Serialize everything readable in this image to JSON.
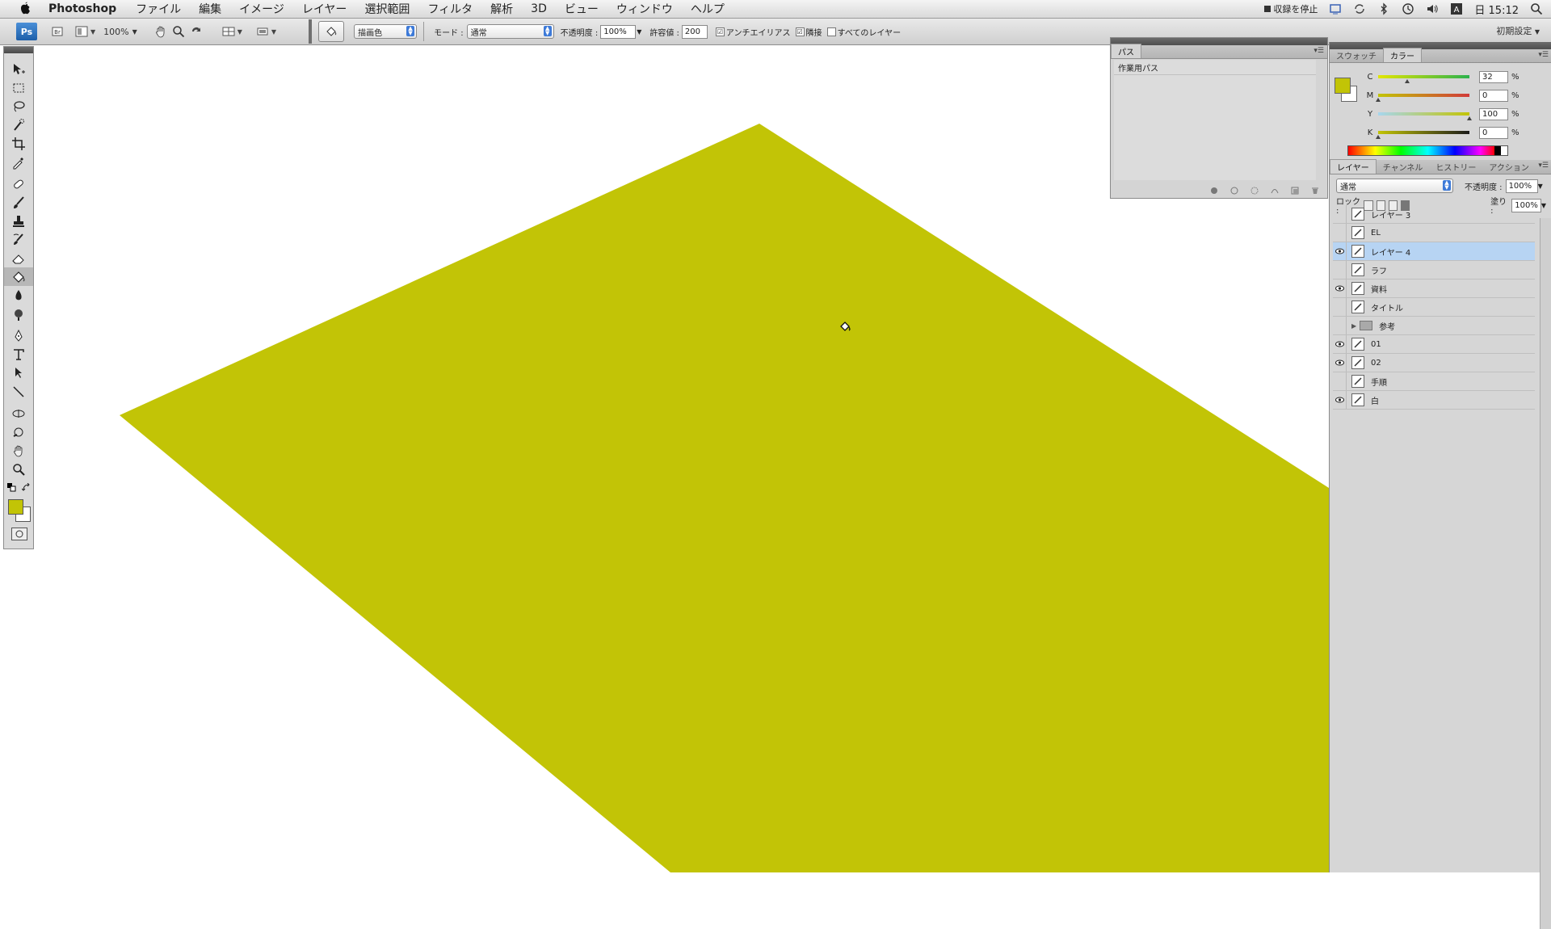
{
  "menubar": {
    "app_name": "Photoshop",
    "menus": [
      "ファイル",
      "編集",
      "イメージ",
      "レイヤー",
      "選択範囲",
      "フィルタ",
      "解析",
      "3D",
      "ビュー",
      "ウィンドウ",
      "ヘルプ"
    ],
    "status_stop": "収録を停止",
    "clock": "日 15:12"
  },
  "appbar": {
    "logo": "Ps",
    "zoom": "100%",
    "workspace": "初期設定"
  },
  "options": {
    "fill_source": "描画色",
    "mode_label": "モード :",
    "mode_value": "通常",
    "opacity_label": "不透明度 :",
    "opacity_value": "100%",
    "tolerance_label": "許容値 :",
    "tolerance_value": "200",
    "antialias_label": "アンチエイリアス",
    "contiguous_label": "隣接",
    "all_layers_label": "すべてのレイヤー",
    "antialias_checked": "☑",
    "contiguous_checked": "☑",
    "all_layers_checked": ""
  },
  "paths_panel": {
    "tab": "パス",
    "items": [
      "作業用パス"
    ]
  },
  "color_panel": {
    "tabs": [
      "スウォッチ",
      "カラー"
    ],
    "foreground_hex": "#c2c406",
    "channels": [
      {
        "label": "C",
        "value": "32",
        "unit": "%",
        "fraction": 0.32
      },
      {
        "label": "M",
        "value": "0",
        "unit": "%",
        "fraction": 0.0
      },
      {
        "label": "Y",
        "value": "100",
        "unit": "%",
        "fraction": 1.0
      },
      {
        "label": "K",
        "value": "0",
        "unit": "%",
        "fraction": 0.0
      }
    ]
  },
  "layers_panel": {
    "tabs": [
      "レイヤー",
      "チャンネル",
      "ヒストリー",
      "アクション"
    ],
    "blend_mode": "通常",
    "opacity_label": "不透明度 :",
    "opacity_value": "100%",
    "lock_label": "ロック :",
    "fill_label": "塗り :",
    "fill_value": "100%",
    "layers": [
      {
        "name": "レイヤー 3",
        "visible": false,
        "selected": false,
        "type": "layer"
      },
      {
        "name": "EL",
        "visible": false,
        "selected": false,
        "type": "layer"
      },
      {
        "name": "レイヤー 4",
        "visible": true,
        "selected": true,
        "type": "layer"
      },
      {
        "name": "ラフ",
        "visible": false,
        "selected": false,
        "type": "layer"
      },
      {
        "name": "資料",
        "visible": true,
        "selected": false,
        "type": "layer"
      },
      {
        "name": "タイトル",
        "visible": false,
        "selected": false,
        "type": "layer"
      },
      {
        "name": "参考",
        "visible": false,
        "selected": false,
        "type": "group"
      },
      {
        "name": "01",
        "visible": true,
        "selected": false,
        "type": "layer"
      },
      {
        "name": "02",
        "visible": true,
        "selected": false,
        "type": "layer"
      },
      {
        "name": "手順",
        "visible": false,
        "selected": false,
        "type": "layer"
      },
      {
        "name": "白",
        "visible": true,
        "selected": false,
        "type": "layer"
      }
    ]
  },
  "canvas": {
    "fill_color": "#c2c406",
    "background": "#ffffff"
  },
  "colors": {
    "selection_blue": "#b7d4f3",
    "accent": "#c2c406"
  }
}
